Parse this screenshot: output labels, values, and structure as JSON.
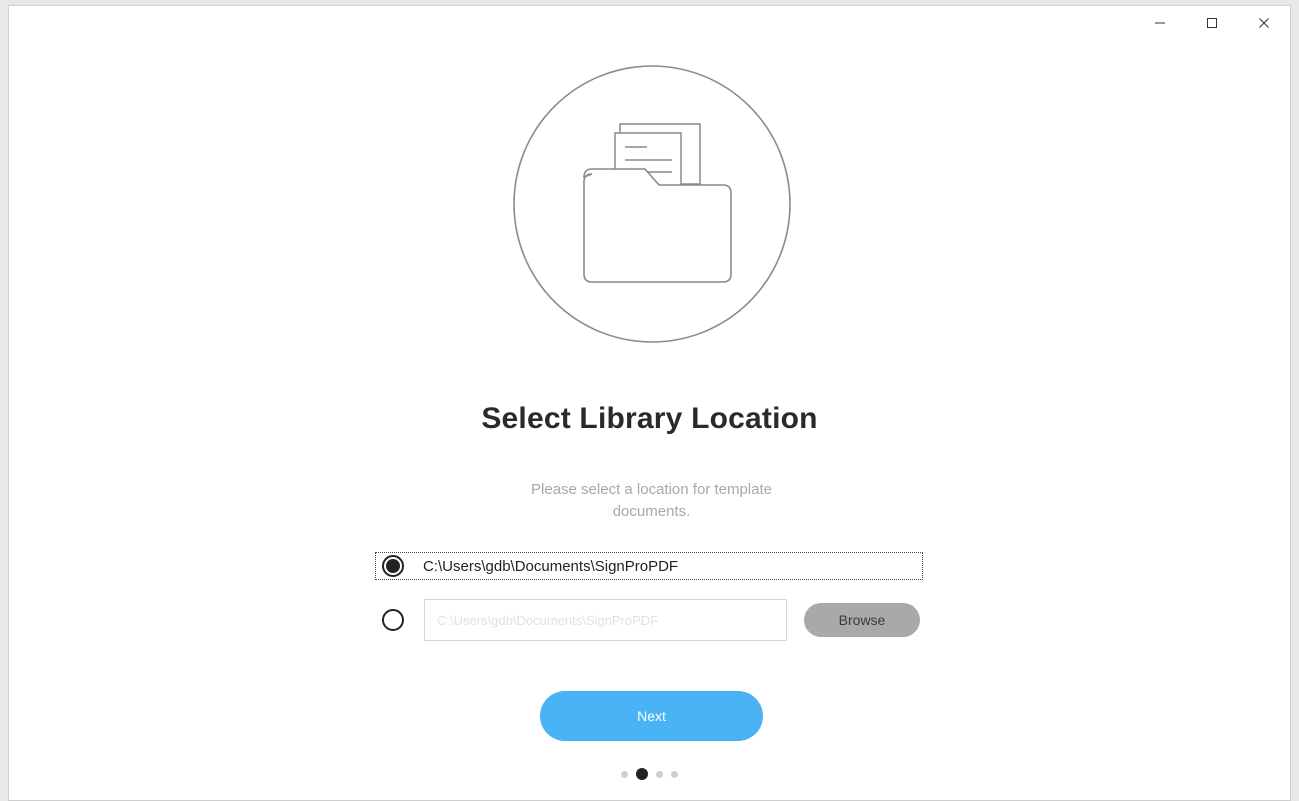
{
  "window": {
    "controls": [
      {
        "name": "minimize",
        "icon": "minimize-icon"
      },
      {
        "name": "maximize",
        "icon": "maximize-icon"
      },
      {
        "name": "close",
        "icon": "close-icon"
      }
    ]
  },
  "illustration": {
    "icon": "folder-document-icon"
  },
  "main": {
    "title": "Select Library Location",
    "subtitle": "Please select a location for template documents."
  },
  "options": {
    "default_path": {
      "label": "C:\\Users\\gdb\\Documents\\SignProPDF",
      "selected": true
    },
    "custom_path": {
      "value": "",
      "placeholder": "C:\\Users\\gdb\\Documents\\SignProPDF",
      "selected": false,
      "browse_label": "Browse"
    }
  },
  "actions": {
    "next_label": "Next"
  },
  "pager": {
    "total": 4,
    "current": 2
  },
  "colors": {
    "accent": "#4ab3f5",
    "browse_bg": "#a9a9a9",
    "title_text": "#2a2a2a",
    "subtitle_text": "#a8a8a8"
  }
}
